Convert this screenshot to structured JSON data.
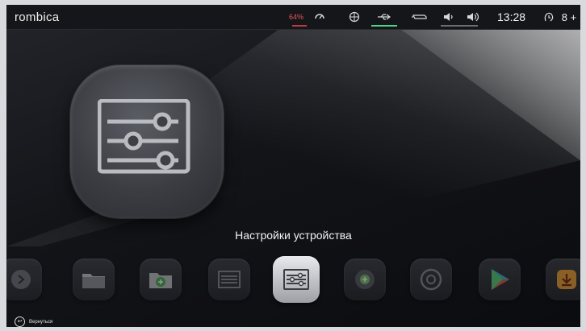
{
  "statusbar": {
    "brand": "rombica",
    "battery": "64%",
    "clock": "13:28",
    "extra": "8 +",
    "accent_green": "#4fd18a",
    "accent_red": "#e0555a",
    "icons": [
      "battery-icon",
      "network-icon",
      "usb-icon",
      "hdmi-icon",
      "volume-icon",
      "volume-loud-icon",
      "alarm-icon"
    ]
  },
  "main": {
    "selected_title": "Настройки устройства",
    "hero_icon": "settings-sliders-icon"
  },
  "dock": {
    "items": [
      {
        "name": "remote-icon"
      },
      {
        "name": "folder-icon"
      },
      {
        "name": "file-manager-icon"
      },
      {
        "name": "settings-grid-icon"
      },
      {
        "name": "device-settings-icon",
        "selected": true
      },
      {
        "name": "add-icon"
      },
      {
        "name": "settings-gear-icon"
      },
      {
        "name": "play-store-icon"
      },
      {
        "name": "download-icon"
      }
    ]
  },
  "footer": {
    "back_label": "Вернуться"
  }
}
